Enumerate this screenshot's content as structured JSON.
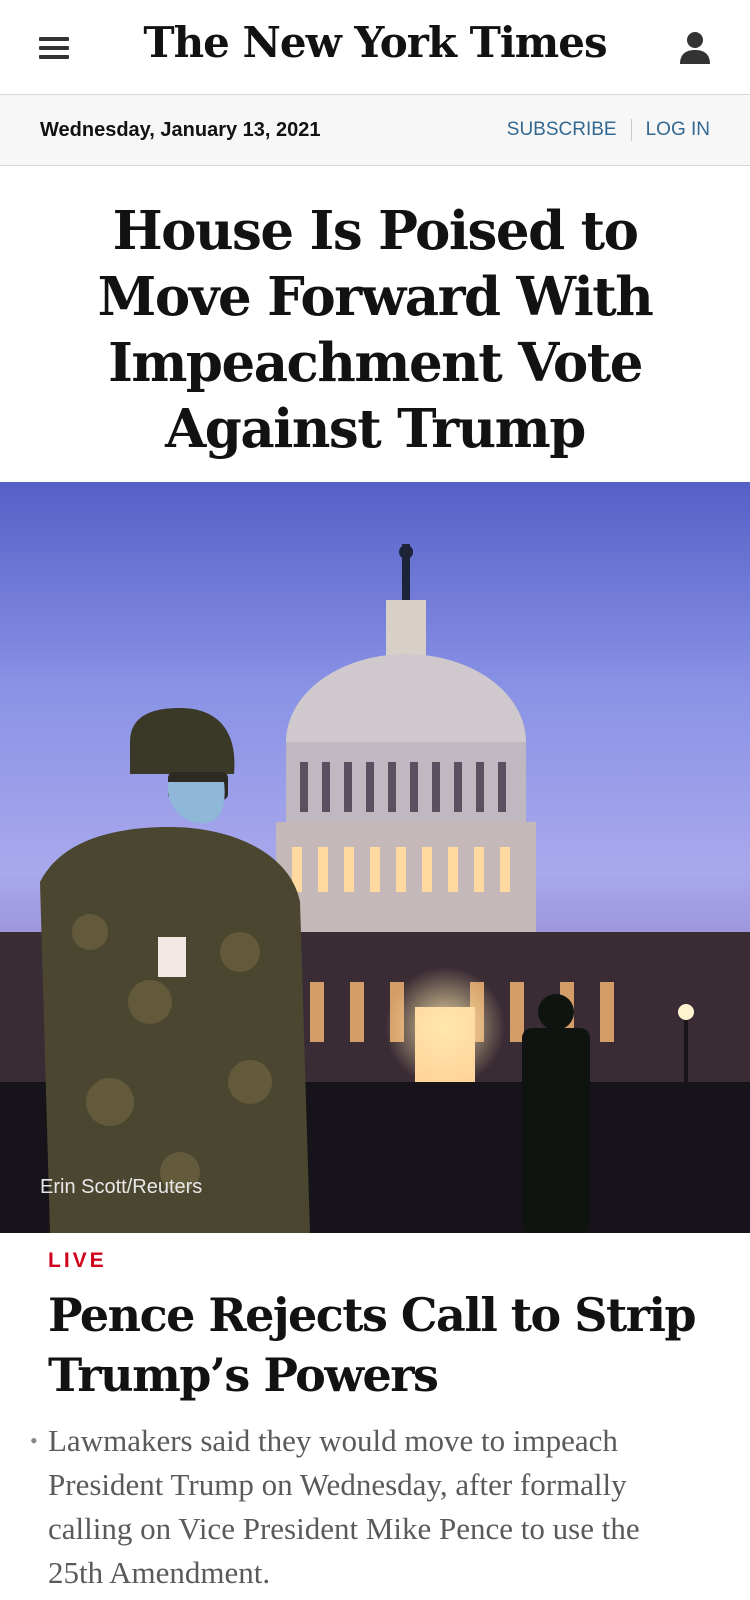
{
  "header": {
    "menu_icon": "hamburger-icon",
    "masthead": "The New York Times",
    "account_icon": "user-icon"
  },
  "datebar": {
    "date": "Wednesday, January 13, 2021",
    "subscribe": "SUBSCRIBE",
    "login": "LOG IN",
    "link_color": "#326891"
  },
  "lead": {
    "headline": "House Is Poised to Move Forward With Impeachment Vote Against Trump",
    "photo_credit": "Erin Scott/Reuters"
  },
  "story": {
    "kicker": "LIVE",
    "kicker_color": "#d0021b",
    "title": "Pence Rejects Call to Strip Trump’s Powers",
    "summary": "Lawmakers said they would move to impeach President Trump on Wednesday, after formally calling on Vice President Mike Pence to use the 25th Amendment."
  }
}
